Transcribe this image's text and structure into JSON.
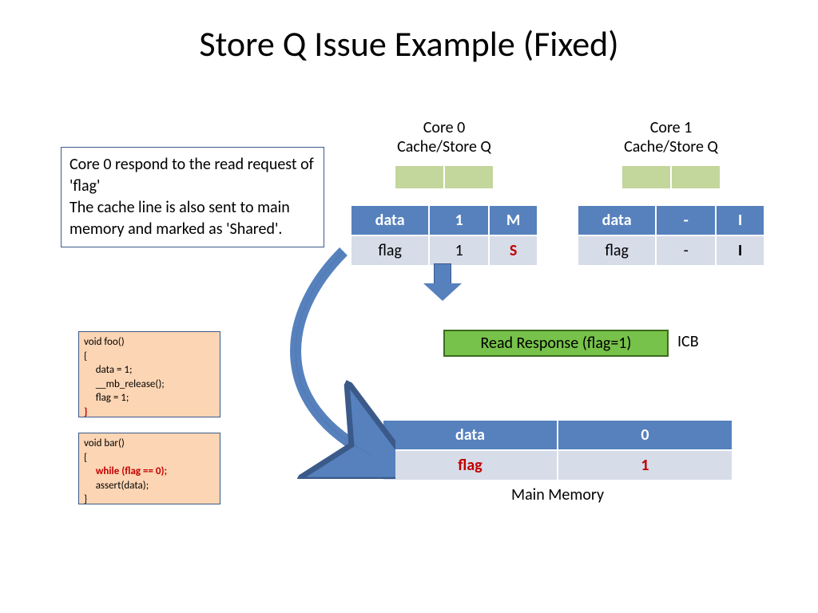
{
  "title": "Store Q Issue Example (Fixed)",
  "description": "Core 0 respond to the read request of 'flag'\nThe cache line is also sent to main memory and marked as 'Shared'.",
  "core0": {
    "label_line1": "Core 0",
    "label_line2": "Cache/Store Q",
    "header": [
      "data",
      "1",
      "M"
    ],
    "row": [
      "flag",
      "1",
      "S"
    ]
  },
  "core1": {
    "label_line1": "Core 1",
    "label_line2": "Cache/Store Q",
    "header": [
      "data",
      "-",
      "I"
    ],
    "row": [
      "flag",
      "-",
      "I"
    ]
  },
  "response": "Read Response (flag=1)",
  "response_bus": "ICB",
  "memory": {
    "header": [
      "data",
      "0"
    ],
    "row": [
      "flag",
      "1"
    ],
    "label": "Main Memory"
  },
  "code_foo": {
    "lines": [
      "void foo()",
      "{",
      "     data = 1;",
      "     __mb_release();",
      "     flag = 1;",
      "}"
    ],
    "red_idx": [
      5
    ]
  },
  "code_bar": {
    "lines": [
      "void bar()",
      "{",
      "     while (flag == 0);",
      "     assert(data);",
      "}"
    ],
    "red_idx": [
      2
    ]
  }
}
